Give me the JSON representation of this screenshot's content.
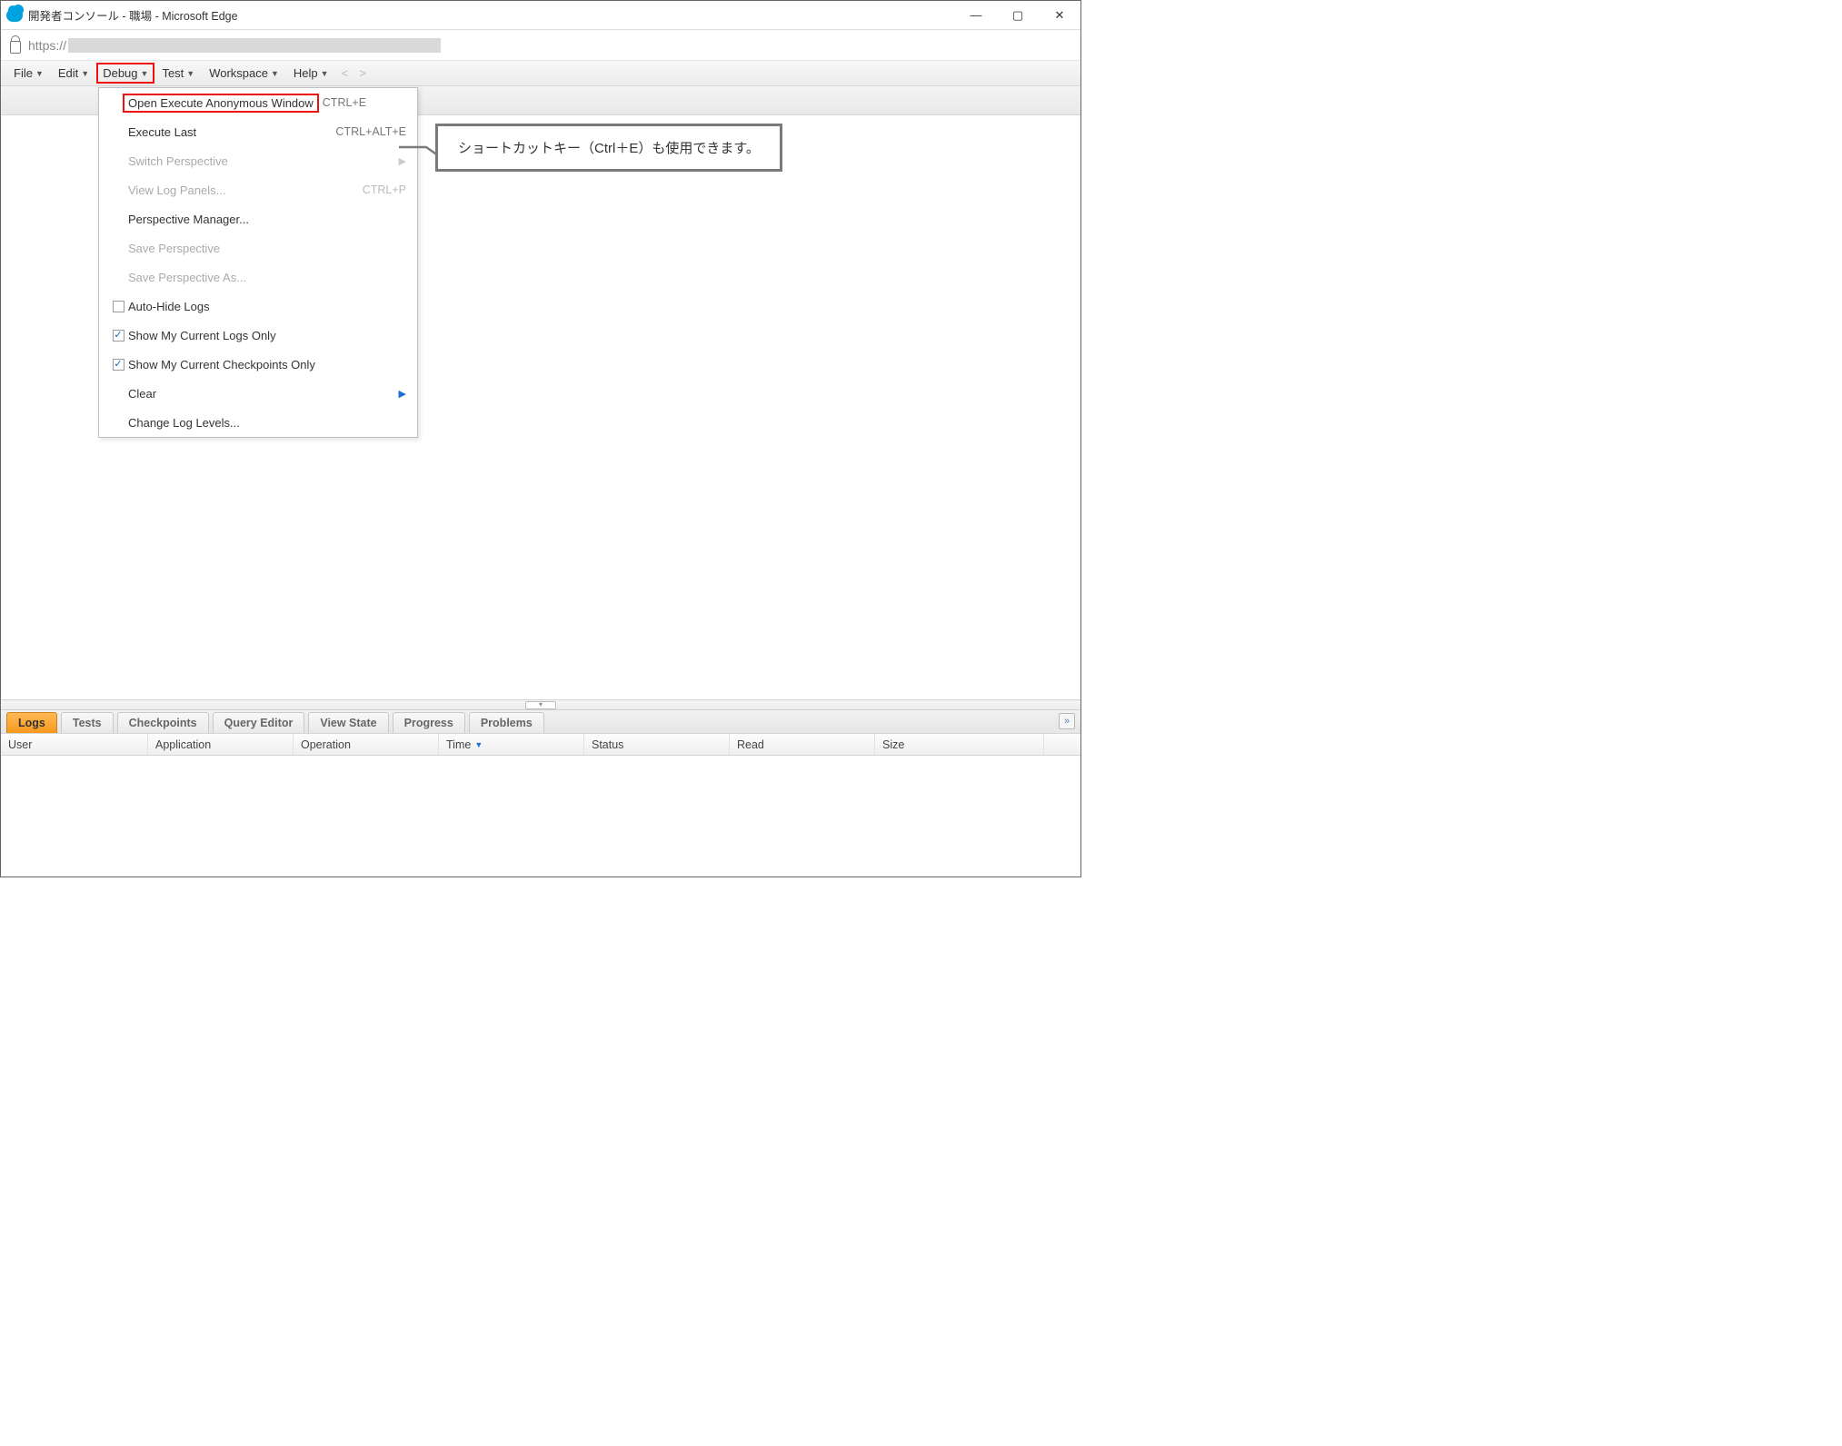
{
  "window": {
    "title": "開発者コンソール - 職場 - Microsoft Edge"
  },
  "address": {
    "scheme": "https://"
  },
  "menubar": {
    "file": "File",
    "edit": "Edit",
    "debug": "Debug",
    "test": "Test",
    "workspace": "Workspace",
    "help": "Help",
    "nav_prev": "<",
    "nav_next": ">"
  },
  "debug_menu": {
    "open_exec_anon": "Open Execute Anonymous Window",
    "open_exec_anon_shortcut": "CTRL+E",
    "execute_last": "Execute Last",
    "execute_last_shortcut": "CTRL+ALT+E",
    "switch_perspective": "Switch Perspective",
    "view_log_panels": "View Log Panels...",
    "view_log_panels_shortcut": "CTRL+P",
    "perspective_manager": "Perspective Manager...",
    "save_perspective": "Save Perspective",
    "save_perspective_as": "Save Perspective As...",
    "auto_hide_logs": "Auto-Hide Logs",
    "show_my_current_logs_only": "Show My Current Logs Only",
    "show_my_current_checkpoints_only": "Show My Current Checkpoints Only",
    "clear": "Clear",
    "change_log_levels": "Change Log Levels..."
  },
  "callout": {
    "text": "ショートカットキー（Ctrl＋E）も使用できます。"
  },
  "bottom_tabs": {
    "logs": "Logs",
    "tests": "Tests",
    "checkpoints": "Checkpoints",
    "query_editor": "Query Editor",
    "view_state": "View State",
    "progress": "Progress",
    "problems": "Problems"
  },
  "columns": {
    "user": "User",
    "application": "Application",
    "operation": "Operation",
    "time": "Time",
    "status": "Status",
    "read": "Read",
    "size": "Size"
  }
}
